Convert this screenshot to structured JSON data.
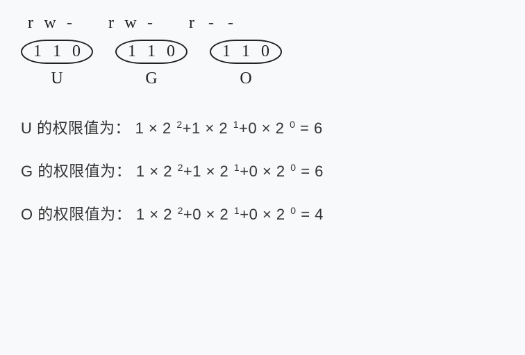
{
  "diagram": {
    "perm_groups": [
      {
        "chars": [
          "r",
          "w",
          "-"
        ],
        "bits": [
          "1",
          "1",
          "0"
        ],
        "label": "U"
      },
      {
        "chars": [
          "r",
          "w",
          "-"
        ],
        "bits": [
          "1",
          "1",
          "0"
        ],
        "label": "G"
      },
      {
        "chars": [
          "r",
          "-",
          "-"
        ],
        "bits": [
          "1",
          "1",
          "0"
        ],
        "label": "O"
      }
    ]
  },
  "formulas": [
    {
      "prefix": "U 的权限值为：",
      "terms": [
        {
          "coef": "1",
          "base": "2",
          "exp": "2"
        },
        {
          "coef": "1",
          "base": "2",
          "exp": "1"
        },
        {
          "coef": "0",
          "base": "2",
          "exp": "0"
        }
      ],
      "result": "6"
    },
    {
      "prefix": "G 的权限值为：",
      "terms": [
        {
          "coef": "1",
          "base": "2",
          "exp": "2"
        },
        {
          "coef": "1",
          "base": "2",
          "exp": "1"
        },
        {
          "coef": "0",
          "base": "2",
          "exp": "0"
        }
      ],
      "result": "6"
    },
    {
      "prefix": "O 的权限值为：",
      "terms": [
        {
          "coef": "1",
          "base": "2",
          "exp": "2"
        },
        {
          "coef": "0",
          "base": "2",
          "exp": "1"
        },
        {
          "coef": "0",
          "base": "2",
          "exp": "0"
        }
      ],
      "result": "4"
    }
  ]
}
